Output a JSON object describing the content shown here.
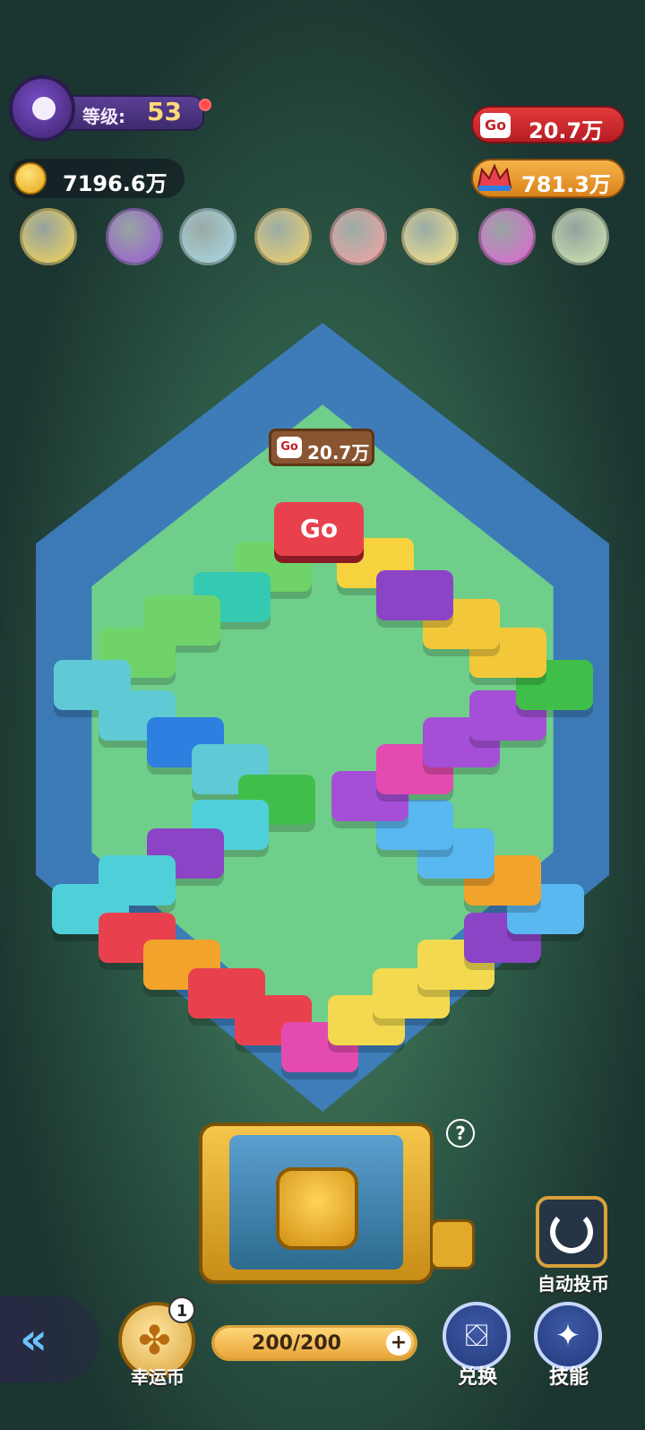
{
  "hud": {
    "level_label": "等级:",
    "level_value": "53",
    "coins": "7196.6万",
    "go_value": "20.7万",
    "crown_value": "781.3万",
    "go_tag": "Go"
  },
  "board": {
    "sign_value": "20.7万",
    "go_tile": "Go"
  },
  "pets": [
    {
      "name": "chick-icon",
      "color": "#f6d85a"
    },
    {
      "name": "book-icon",
      "color": "#9b5bd6"
    },
    {
      "name": "owl-icon",
      "color": "#a9d9e6"
    },
    {
      "name": "cheese-icon",
      "color": "#f2d26b"
    },
    {
      "name": "pig-icon",
      "color": "#f5a3a3"
    },
    {
      "name": "fish-icon",
      "color": "#f7e58c"
    },
    {
      "name": "gem-icon",
      "color": "#e065d6"
    },
    {
      "name": "bird-icon",
      "color": "#cfe8b0"
    }
  ],
  "bottom": {
    "back_arrow": "«",
    "lucky_badge": "1",
    "lucky_label": "幸运币",
    "energy": "200/200",
    "energy_fraction": 1.0,
    "plus": "+",
    "exchange_label": "兑换",
    "skill_label": "技能",
    "auto_label": "自动投币",
    "help": "?"
  }
}
